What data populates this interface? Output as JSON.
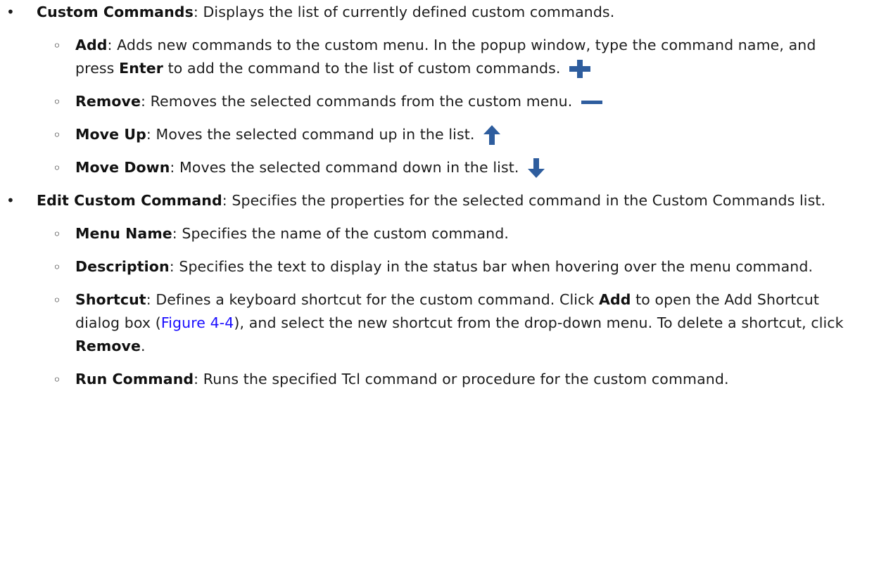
{
  "items": [
    {
      "term": "Custom Commands",
      "desc": ": Displays the list of currently defined custom commands.",
      "subs": [
        {
          "term": "Add",
          "desc_1": ": Adds new commands to the custom menu. In the popup window, type the command name, and press ",
          "bold_1": "Enter",
          "desc_2": " to add the command to the list of custom commands.",
          "icon": "plus-icon"
        },
        {
          "term": "Remove",
          "desc_1": ": Removes the selected commands from the custom menu.",
          "icon": "minus-icon"
        },
        {
          "term": "Move Up",
          "desc_1": ": Moves the selected command up in the list.",
          "icon": "arrow-up-icon"
        },
        {
          "term": "Move Down",
          "desc_1": ": Moves the selected command down in the list.",
          "icon": "arrow-down-icon"
        }
      ]
    },
    {
      "term": "Edit Custom Command",
      "desc": ": Specifies the properties for the selected command in the Custom Commands list.",
      "subs": [
        {
          "term": "Menu Name",
          "desc_1": ": Specifies the name of the custom command."
        },
        {
          "term": "Description",
          "desc_1": ": Specifies the text to display in the status bar when hovering over the menu command."
        },
        {
          "term": "Shortcut",
          "desc_1": ": Defines a keyboard shortcut for the custom command. Click ",
          "bold_1": "Add",
          "desc_2": " to open the Add Shortcut dialog box (",
          "link": "Figure 4-4",
          "desc_3": "), and select the new shortcut from the drop-down menu. To delete a shortcut, click ",
          "bold_2": "Remove",
          "desc_4": "."
        },
        {
          "term": "Run Command",
          "desc_1": ": Runs the specified Tcl command or procedure for the custom command."
        }
      ]
    }
  ],
  "bullets": {
    "primary": "•",
    "secondary": "◦"
  },
  "colors": {
    "icon_blue": "#2e5d9e",
    "link": "#1a0dff"
  }
}
